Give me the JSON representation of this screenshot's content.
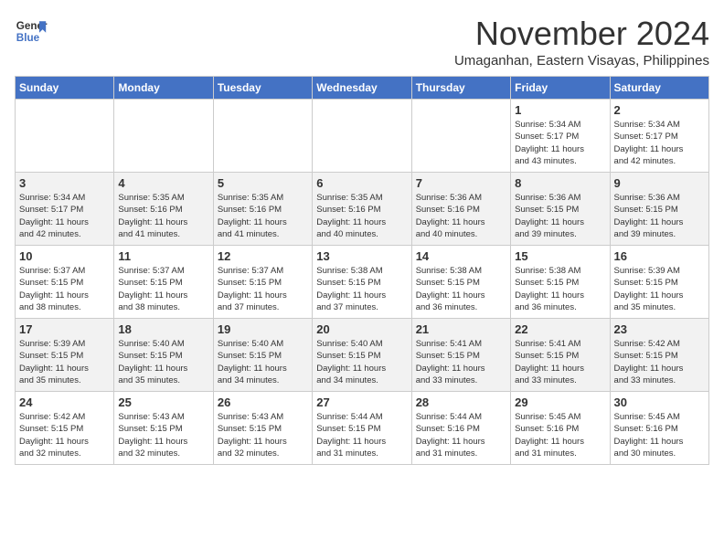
{
  "header": {
    "logo_line1": "General",
    "logo_line2": "Blue",
    "month": "November 2024",
    "location": "Umaganhan, Eastern Visayas, Philippines"
  },
  "weekdays": [
    "Sunday",
    "Monday",
    "Tuesday",
    "Wednesday",
    "Thursday",
    "Friday",
    "Saturday"
  ],
  "weeks": [
    [
      {
        "day": "",
        "info": ""
      },
      {
        "day": "",
        "info": ""
      },
      {
        "day": "",
        "info": ""
      },
      {
        "day": "",
        "info": ""
      },
      {
        "day": "",
        "info": ""
      },
      {
        "day": "1",
        "info": "Sunrise: 5:34 AM\nSunset: 5:17 PM\nDaylight: 11 hours\nand 43 minutes."
      },
      {
        "day": "2",
        "info": "Sunrise: 5:34 AM\nSunset: 5:17 PM\nDaylight: 11 hours\nand 42 minutes."
      }
    ],
    [
      {
        "day": "3",
        "info": "Sunrise: 5:34 AM\nSunset: 5:17 PM\nDaylight: 11 hours\nand 42 minutes."
      },
      {
        "day": "4",
        "info": "Sunrise: 5:35 AM\nSunset: 5:16 PM\nDaylight: 11 hours\nand 41 minutes."
      },
      {
        "day": "5",
        "info": "Sunrise: 5:35 AM\nSunset: 5:16 PM\nDaylight: 11 hours\nand 41 minutes."
      },
      {
        "day": "6",
        "info": "Sunrise: 5:35 AM\nSunset: 5:16 PM\nDaylight: 11 hours\nand 40 minutes."
      },
      {
        "day": "7",
        "info": "Sunrise: 5:36 AM\nSunset: 5:16 PM\nDaylight: 11 hours\nand 40 minutes."
      },
      {
        "day": "8",
        "info": "Sunrise: 5:36 AM\nSunset: 5:15 PM\nDaylight: 11 hours\nand 39 minutes."
      },
      {
        "day": "9",
        "info": "Sunrise: 5:36 AM\nSunset: 5:15 PM\nDaylight: 11 hours\nand 39 minutes."
      }
    ],
    [
      {
        "day": "10",
        "info": "Sunrise: 5:37 AM\nSunset: 5:15 PM\nDaylight: 11 hours\nand 38 minutes."
      },
      {
        "day": "11",
        "info": "Sunrise: 5:37 AM\nSunset: 5:15 PM\nDaylight: 11 hours\nand 38 minutes."
      },
      {
        "day": "12",
        "info": "Sunrise: 5:37 AM\nSunset: 5:15 PM\nDaylight: 11 hours\nand 37 minutes."
      },
      {
        "day": "13",
        "info": "Sunrise: 5:38 AM\nSunset: 5:15 PM\nDaylight: 11 hours\nand 37 minutes."
      },
      {
        "day": "14",
        "info": "Sunrise: 5:38 AM\nSunset: 5:15 PM\nDaylight: 11 hours\nand 36 minutes."
      },
      {
        "day": "15",
        "info": "Sunrise: 5:38 AM\nSunset: 5:15 PM\nDaylight: 11 hours\nand 36 minutes."
      },
      {
        "day": "16",
        "info": "Sunrise: 5:39 AM\nSunset: 5:15 PM\nDaylight: 11 hours\nand 35 minutes."
      }
    ],
    [
      {
        "day": "17",
        "info": "Sunrise: 5:39 AM\nSunset: 5:15 PM\nDaylight: 11 hours\nand 35 minutes."
      },
      {
        "day": "18",
        "info": "Sunrise: 5:40 AM\nSunset: 5:15 PM\nDaylight: 11 hours\nand 35 minutes."
      },
      {
        "day": "19",
        "info": "Sunrise: 5:40 AM\nSunset: 5:15 PM\nDaylight: 11 hours\nand 34 minutes."
      },
      {
        "day": "20",
        "info": "Sunrise: 5:40 AM\nSunset: 5:15 PM\nDaylight: 11 hours\nand 34 minutes."
      },
      {
        "day": "21",
        "info": "Sunrise: 5:41 AM\nSunset: 5:15 PM\nDaylight: 11 hours\nand 33 minutes."
      },
      {
        "day": "22",
        "info": "Sunrise: 5:41 AM\nSunset: 5:15 PM\nDaylight: 11 hours\nand 33 minutes."
      },
      {
        "day": "23",
        "info": "Sunrise: 5:42 AM\nSunset: 5:15 PM\nDaylight: 11 hours\nand 33 minutes."
      }
    ],
    [
      {
        "day": "24",
        "info": "Sunrise: 5:42 AM\nSunset: 5:15 PM\nDaylight: 11 hours\nand 32 minutes."
      },
      {
        "day": "25",
        "info": "Sunrise: 5:43 AM\nSunset: 5:15 PM\nDaylight: 11 hours\nand 32 minutes."
      },
      {
        "day": "26",
        "info": "Sunrise: 5:43 AM\nSunset: 5:15 PM\nDaylight: 11 hours\nand 32 minutes."
      },
      {
        "day": "27",
        "info": "Sunrise: 5:44 AM\nSunset: 5:15 PM\nDaylight: 11 hours\nand 31 minutes."
      },
      {
        "day": "28",
        "info": "Sunrise: 5:44 AM\nSunset: 5:16 PM\nDaylight: 11 hours\nand 31 minutes."
      },
      {
        "day": "29",
        "info": "Sunrise: 5:45 AM\nSunset: 5:16 PM\nDaylight: 11 hours\nand 31 minutes."
      },
      {
        "day": "30",
        "info": "Sunrise: 5:45 AM\nSunset: 5:16 PM\nDaylight: 11 hours\nand 30 minutes."
      }
    ]
  ]
}
